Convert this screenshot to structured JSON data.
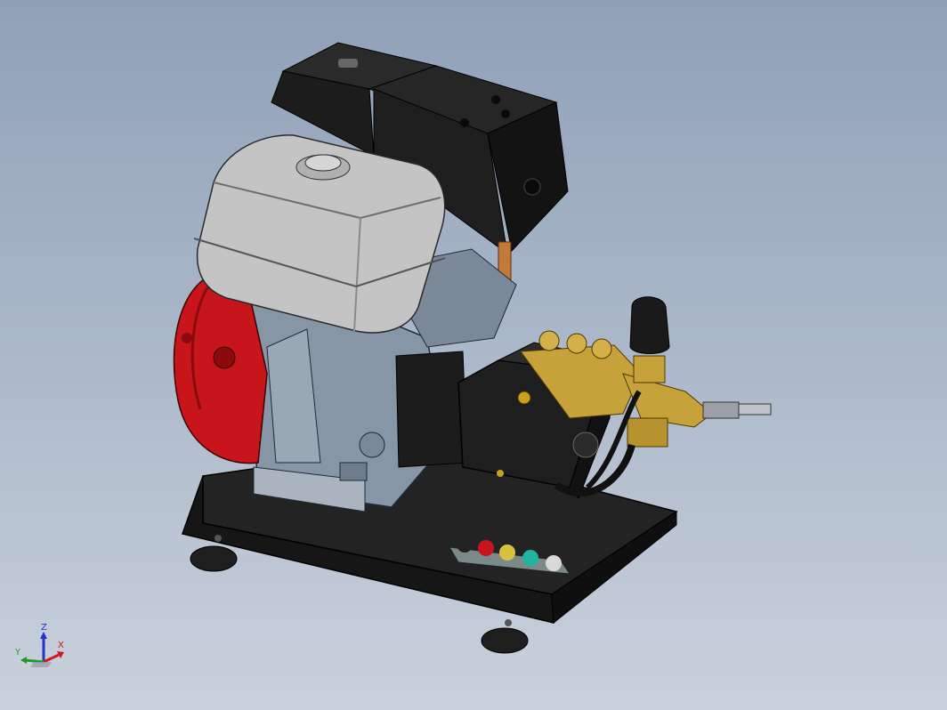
{
  "viewport": {
    "background_top": "#8fa0b8",
    "background_bottom": "#c9d1dc"
  },
  "model": {
    "parts": [
      "fuel-tank",
      "air-filter-housing",
      "recoil-starter",
      "engine-block",
      "pump-gearbox",
      "pump-manifold",
      "unloader-valve",
      "base-frame",
      "nozzle-tips"
    ],
    "colors": {
      "tank": "#c9c9c9",
      "engine": "#8796a6",
      "starter": "#c8151b",
      "black_parts": "#1b1b1b",
      "brass": "#c7a13a",
      "nozzle_colors": [
        "#222222",
        "#c8151b",
        "#d8c23a",
        "#1fb3a0",
        "#d9d9d9"
      ]
    }
  },
  "triad": {
    "z_label": "Z",
    "y_label": "Y",
    "x_label": "X",
    "z_color": "#2233cc",
    "y_color": "#1f9a2a",
    "x_color": "#d01a1a"
  }
}
